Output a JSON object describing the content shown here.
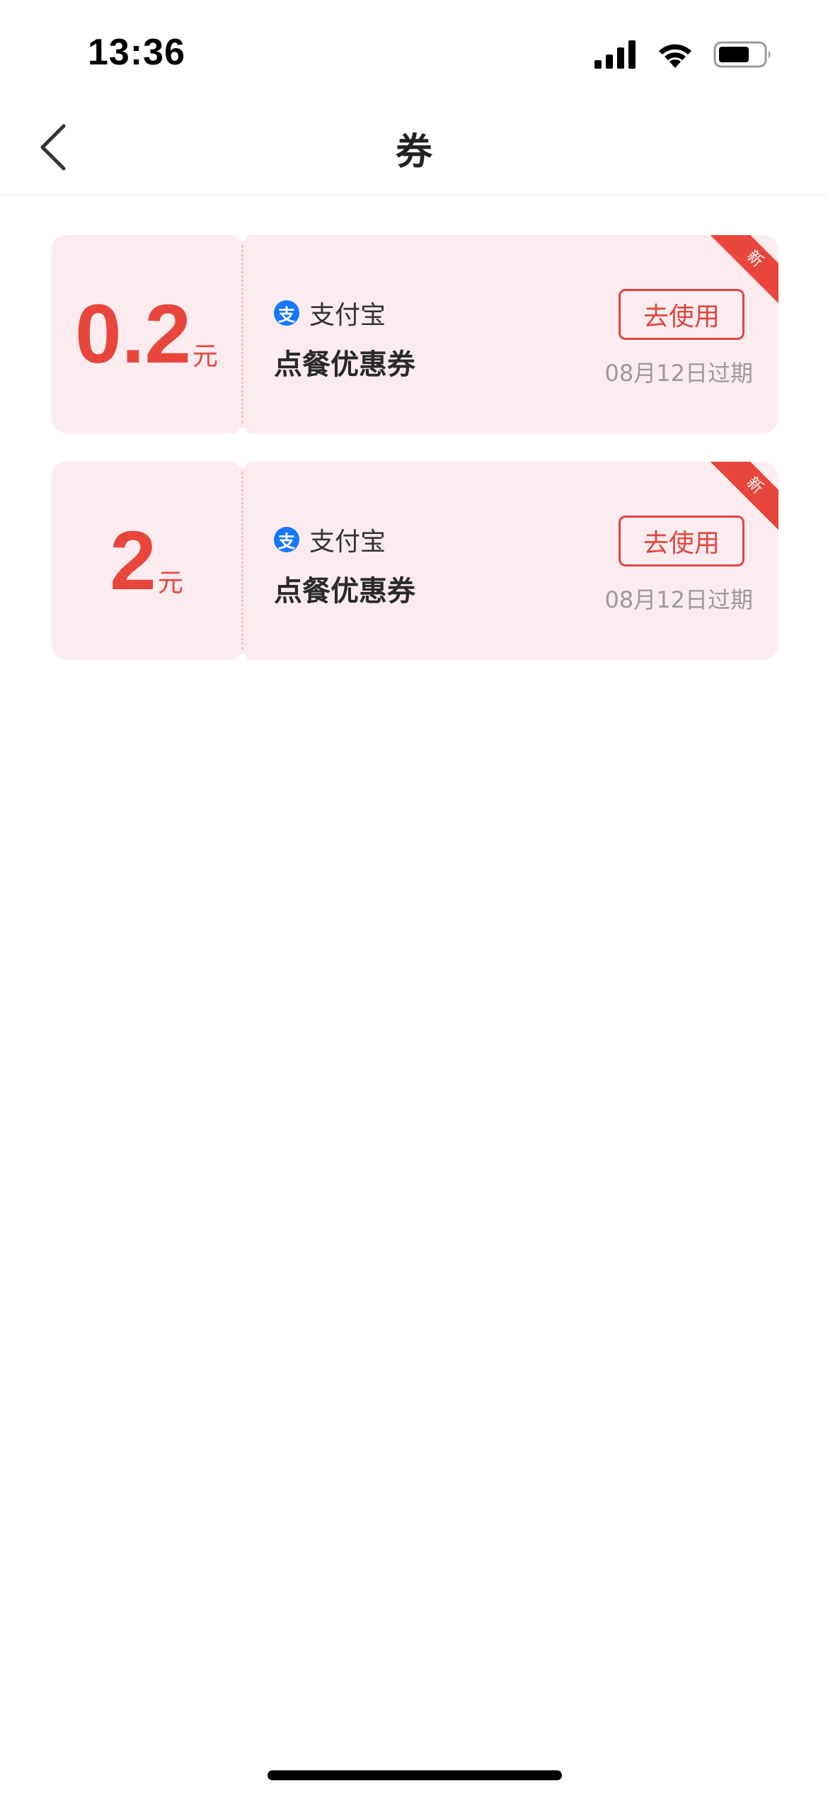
{
  "status_bar": {
    "time": "13:36"
  },
  "nav": {
    "title": "券",
    "back_icon": "chevron-left-icon"
  },
  "coupons": [
    {
      "amount": "0.2",
      "unit": "元",
      "brand": "支付宝",
      "brand_icon_glyph": "支",
      "name": "点餐优惠券",
      "button_label": "去使用",
      "expire": "08月12日过期",
      "badge": "新"
    },
    {
      "amount": "2",
      "unit": "元",
      "brand": "支付宝",
      "brand_icon_glyph": "支",
      "name": "点餐优惠券",
      "button_label": "去使用",
      "expire": "08月12日过期",
      "badge": "新"
    }
  ],
  "colors": {
    "accent": "#e8453c",
    "coupon_bg": "#fdecef",
    "alipay_blue": "#1677ff"
  }
}
